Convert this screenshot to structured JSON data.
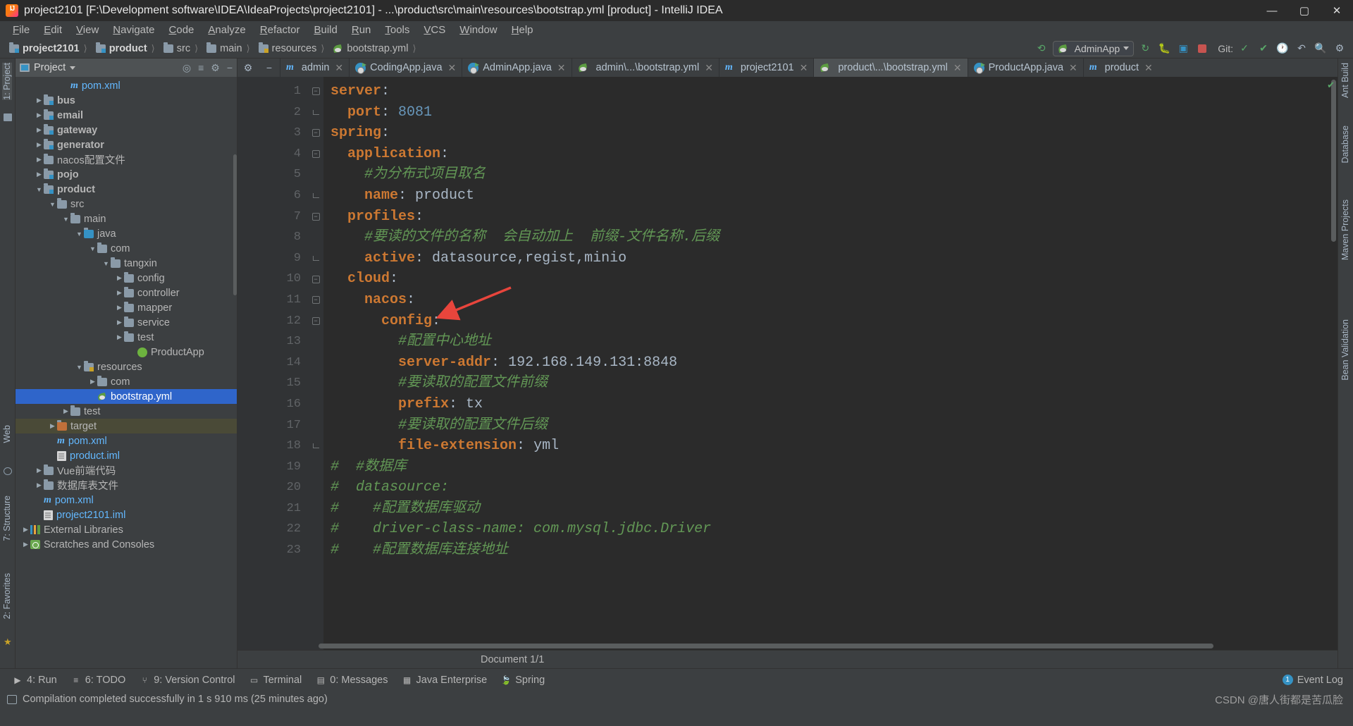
{
  "window": {
    "title": "project2101 [F:\\Development software\\IDEA\\IdeaProjects\\project2101] - ...\\product\\src\\main\\resources\\bootstrap.yml [product] - IntelliJ IDEA",
    "minimize": "—",
    "maximize": "▢",
    "close": "✕",
    "app_icon": "intellij-idea-icon"
  },
  "menu": [
    "File",
    "Edit",
    "View",
    "Navigate",
    "Code",
    "Analyze",
    "Refactor",
    "Build",
    "Run",
    "Tools",
    "VCS",
    "Window",
    "Help"
  ],
  "breadcrumb": [
    {
      "label": "project2101",
      "icon": "module-folder-icon",
      "bold": true
    },
    {
      "label": "product",
      "icon": "module-folder-icon",
      "bold": true
    },
    {
      "label": "src",
      "icon": "folder-icon",
      "bold": false
    },
    {
      "label": "main",
      "icon": "folder-icon",
      "bold": false
    },
    {
      "label": "resources",
      "icon": "resources-folder-icon",
      "bold": false
    },
    {
      "label": "bootstrap.yml",
      "icon": "spring-leaf-icon",
      "bold": false
    }
  ],
  "toolbar": {
    "run_config": "AdminApp",
    "git_label": "Git:",
    "icons": [
      "build-hammer-icon",
      "rerun-icon",
      "debug-icon",
      "coverage-icon",
      "stop-icon",
      "git-branch-icon",
      "git-check-icon",
      "history-icon",
      "undo-icon",
      "search-everywhere-icon",
      "settings-icon"
    ]
  },
  "tabs": [
    {
      "label": "admin",
      "icon": "maven-icon",
      "active": false
    },
    {
      "label": "CodingApp.java",
      "icon": "java-run-icon",
      "active": false
    },
    {
      "label": "AdminApp.java",
      "icon": "java-run-icon",
      "active": false
    },
    {
      "label": "admin\\...\\bootstrap.yml",
      "icon": "spring-leaf-icon",
      "active": false
    },
    {
      "label": "project2101",
      "icon": "maven-icon",
      "active": false
    },
    {
      "label": "product\\...\\bootstrap.yml",
      "icon": "spring-leaf-icon",
      "active": true
    },
    {
      "label": "ProductApp.java",
      "icon": "java-run-icon",
      "active": false
    },
    {
      "label": "product",
      "icon": "maven-icon",
      "active": false
    }
  ],
  "project_panel": {
    "title": "Project",
    "dropdown": "▾",
    "locate_icon": "locate-icon",
    "collapse_icon": "collapse-all-icon",
    "hide_icon": "hide-icon",
    "settings_icon": "gear-icon",
    "tree": [
      {
        "label": "pom.xml",
        "indent": 3,
        "arrow": "",
        "icon": "maven-xml-icon",
        "bold": false
      },
      {
        "label": "bus",
        "indent": 1,
        "arrow": "▶",
        "icon": "module-folder-icon",
        "bold": true
      },
      {
        "label": "email",
        "indent": 1,
        "arrow": "▶",
        "icon": "module-folder-icon",
        "bold": true
      },
      {
        "label": "gateway",
        "indent": 1,
        "arrow": "▶",
        "icon": "module-folder-icon",
        "bold": true
      },
      {
        "label": "generator",
        "indent": 1,
        "arrow": "▶",
        "icon": "module-folder-icon",
        "bold": true
      },
      {
        "label": "nacos配置文件",
        "indent": 1,
        "arrow": "▶",
        "icon": "folder-icon",
        "bold": false
      },
      {
        "label": "pojo",
        "indent": 1,
        "arrow": "▶",
        "icon": "module-folder-icon",
        "bold": true
      },
      {
        "label": "product",
        "indent": 1,
        "arrow": "▼",
        "icon": "module-folder-icon",
        "bold": true
      },
      {
        "label": "src",
        "indent": 2,
        "arrow": "▼",
        "icon": "folder-icon",
        "bold": false
      },
      {
        "label": "main",
        "indent": 3,
        "arrow": "▼",
        "icon": "folder-icon",
        "bold": false
      },
      {
        "label": "java",
        "indent": 4,
        "arrow": "▼",
        "icon": "source-folder-icon",
        "bold": false
      },
      {
        "label": "com",
        "indent": 5,
        "arrow": "▼",
        "icon": "package-icon",
        "bold": false
      },
      {
        "label": "tangxin",
        "indent": 6,
        "arrow": "▼",
        "icon": "package-icon",
        "bold": false
      },
      {
        "label": "config",
        "indent": 7,
        "arrow": "▶",
        "icon": "package-icon",
        "bold": false
      },
      {
        "label": "controller",
        "indent": 7,
        "arrow": "▶",
        "icon": "package-icon",
        "bold": false
      },
      {
        "label": "mapper",
        "indent": 7,
        "arrow": "▶",
        "icon": "package-icon",
        "bold": false
      },
      {
        "label": "service",
        "indent": 7,
        "arrow": "▶",
        "icon": "package-icon",
        "bold": false
      },
      {
        "label": "test",
        "indent": 7,
        "arrow": "▶",
        "icon": "package-icon",
        "bold": false
      },
      {
        "label": "ProductApp",
        "indent": 8,
        "arrow": "",
        "icon": "spring-class-icon",
        "bold": false
      },
      {
        "label": "resources",
        "indent": 4,
        "arrow": "▼",
        "icon": "resources-folder-icon",
        "bold": false
      },
      {
        "label": "com",
        "indent": 5,
        "arrow": "▶",
        "icon": "folder-icon",
        "bold": false
      },
      {
        "label": "bootstrap.yml",
        "indent": 5,
        "arrow": "",
        "icon": "spring-leaf-icon",
        "bold": false,
        "selected": true
      },
      {
        "label": "test",
        "indent": 3,
        "arrow": "▶",
        "icon": "folder-icon",
        "bold": false
      },
      {
        "label": "target",
        "indent": 2,
        "arrow": "▶",
        "icon": "target-folder-icon",
        "bold": false,
        "highlight": true
      },
      {
        "label": "pom.xml",
        "indent": 2,
        "arrow": "",
        "icon": "maven-xml-icon",
        "bold": false
      },
      {
        "label": "product.iml",
        "indent": 2,
        "arrow": "",
        "icon": "iml-icon",
        "bold": false
      },
      {
        "label": "Vue前端代码",
        "indent": 1,
        "arrow": "▶",
        "icon": "folder-icon",
        "bold": false
      },
      {
        "label": "数据库表文件",
        "indent": 1,
        "arrow": "▶",
        "icon": "folder-icon",
        "bold": false
      },
      {
        "label": "pom.xml",
        "indent": 1,
        "arrow": "",
        "icon": "maven-xml-icon",
        "bold": false
      },
      {
        "label": "project2101.iml",
        "indent": 1,
        "arrow": "",
        "icon": "iml-icon",
        "bold": false
      },
      {
        "label": "External Libraries",
        "indent": 0,
        "arrow": "▶",
        "icon": "library-icon",
        "bold": false
      },
      {
        "label": "Scratches and Consoles",
        "indent": 0,
        "arrow": "▶",
        "icon": "scratches-icon",
        "bold": false
      }
    ]
  },
  "left_strip": [
    "1: Project",
    "7: Structure",
    "2: Favorites",
    "Web"
  ],
  "right_strip": [
    "Ant Build",
    "Database",
    "Maven Projects",
    "Bean Validation"
  ],
  "editor": {
    "language": "yaml",
    "lines": [
      {
        "n": 1,
        "fold": "minus",
        "segs": [
          {
            "t": "server",
            "c": "key"
          },
          {
            "t": ":",
            "c": "plain"
          }
        ],
        "indent": 0
      },
      {
        "n": 2,
        "fold": "arm",
        "segs": [
          {
            "t": "  port",
            "c": "key"
          },
          {
            "t": ": ",
            "c": "plain"
          },
          {
            "t": "8081",
            "c": "num"
          }
        ],
        "indent": 0
      },
      {
        "n": 3,
        "fold": "minus",
        "segs": [
          {
            "t": "spring",
            "c": "key"
          },
          {
            "t": ":",
            "c": "plain"
          }
        ],
        "indent": 0
      },
      {
        "n": 4,
        "fold": "minus2",
        "segs": [
          {
            "t": "  application",
            "c": "key"
          },
          {
            "t": ":",
            "c": "plain"
          }
        ],
        "indent": 0
      },
      {
        "n": 5,
        "fold": "",
        "segs": [
          {
            "t": "    #为分布式项目取名",
            "c": "cmt"
          }
        ],
        "indent": 0
      },
      {
        "n": 6,
        "fold": "arm",
        "segs": [
          {
            "t": "    name",
            "c": "key"
          },
          {
            "t": ": ",
            "c": "plain"
          },
          {
            "t": "product",
            "c": "val"
          }
        ],
        "indent": 0
      },
      {
        "n": 7,
        "fold": "minus2",
        "segs": [
          {
            "t": "  profiles",
            "c": "key"
          },
          {
            "t": ":",
            "c": "plain"
          }
        ],
        "indent": 0
      },
      {
        "n": 8,
        "fold": "",
        "segs": [
          {
            "t": "    #要读的文件的名称  会自动加上  前缀-文件名称.后缀",
            "c": "cmt"
          }
        ],
        "indent": 0
      },
      {
        "n": 9,
        "fold": "arm",
        "segs": [
          {
            "t": "    active",
            "c": "key"
          },
          {
            "t": ": ",
            "c": "plain"
          },
          {
            "t": "datasource,regist,minio",
            "c": "val"
          }
        ],
        "indent": 0
      },
      {
        "n": 10,
        "fold": "minus",
        "segs": [
          {
            "t": "  cloud",
            "c": "key"
          },
          {
            "t": ":",
            "c": "plain"
          }
        ],
        "indent": 0
      },
      {
        "n": 11,
        "fold": "minus2",
        "segs": [
          {
            "t": "    nacos",
            "c": "key"
          },
          {
            "t": ":",
            "c": "plain"
          }
        ],
        "indent": 0
      },
      {
        "n": 12,
        "fold": "minus2",
        "segs": [
          {
            "t": "      config",
            "c": "key"
          },
          {
            "t": ":",
            "c": "plain"
          }
        ],
        "indent": 0
      },
      {
        "n": 13,
        "fold": "",
        "segs": [
          {
            "t": "        #配置中心地址",
            "c": "cmt"
          }
        ],
        "indent": 0
      },
      {
        "n": 14,
        "fold": "",
        "segs": [
          {
            "t": "        server-addr",
            "c": "key"
          },
          {
            "t": ": ",
            "c": "plain"
          },
          {
            "t": "192.168.149.131:8848",
            "c": "val"
          }
        ],
        "indent": 0
      },
      {
        "n": 15,
        "fold": "",
        "segs": [
          {
            "t": "        #要读取的配置文件前缀",
            "c": "cmt"
          }
        ],
        "indent": 0
      },
      {
        "n": 16,
        "fold": "",
        "segs": [
          {
            "t": "        prefix",
            "c": "key"
          },
          {
            "t": ": ",
            "c": "plain"
          },
          {
            "t": "tx",
            "c": "val"
          }
        ],
        "indent": 0
      },
      {
        "n": 17,
        "fold": "",
        "segs": [
          {
            "t": "        #要读取的配置文件后缀",
            "c": "cmt"
          }
        ],
        "indent": 0
      },
      {
        "n": 18,
        "fold": "arm",
        "segs": [
          {
            "t": "        file-extension",
            "c": "key"
          },
          {
            "t": ": ",
            "c": "plain"
          },
          {
            "t": "yml",
            "c": "val"
          }
        ],
        "indent": 0
      },
      {
        "n": 19,
        "fold": "",
        "segs": [
          {
            "t": "#  #数据库",
            "c": "cmt"
          }
        ],
        "indent": 0
      },
      {
        "n": 20,
        "fold": "",
        "segs": [
          {
            "t": "#  datasource:",
            "c": "cmt"
          }
        ],
        "indent": 0
      },
      {
        "n": 21,
        "fold": "",
        "segs": [
          {
            "t": "#    #配置数据库驱动",
            "c": "cmt"
          }
        ],
        "indent": 0
      },
      {
        "n": 22,
        "fold": "",
        "segs": [
          {
            "t": "#    driver-class-name: com.mysql.jdbc.Driver",
            "c": "cmt"
          }
        ],
        "indent": 0
      },
      {
        "n": 23,
        "fold": "",
        "segs": [
          {
            "t": "#    #配置数据库连接地址",
            "c": "cmt"
          }
        ],
        "indent": 0
      }
    ],
    "annotation_arrow": "red-arrow-annotation"
  },
  "document_footer": {
    "label": "Document 1/1"
  },
  "bottom_tools": [
    {
      "label": "4: Run",
      "icon": "run-icon"
    },
    {
      "label": "6: TODO",
      "icon": "todo-icon"
    },
    {
      "label": "9: Version Control",
      "icon": "version-control-icon"
    },
    {
      "label": "Terminal",
      "icon": "terminal-icon"
    },
    {
      "label": "0: Messages",
      "icon": "messages-icon"
    },
    {
      "label": "Java Enterprise",
      "icon": "java-enterprise-icon"
    },
    {
      "label": "Spring",
      "icon": "spring-leaf-icon"
    }
  ],
  "event_log": {
    "label": "Event Log",
    "count": "1"
  },
  "status": {
    "message": "Compilation completed successfully in 1 s 910 ms (25 minutes ago)",
    "icon": "build-status-icon",
    "watermark": "CSDN @唐人街都是苦瓜脸"
  },
  "colors": {
    "accent": "#3592c4",
    "selection": "#2f65ca",
    "keyword": "#cc7832",
    "comment": "#629755",
    "number": "#6897bb",
    "text": "#a9b7c6",
    "background": "#2b2b2b",
    "panel": "#3c3f41",
    "arrow": "#e8453c"
  }
}
